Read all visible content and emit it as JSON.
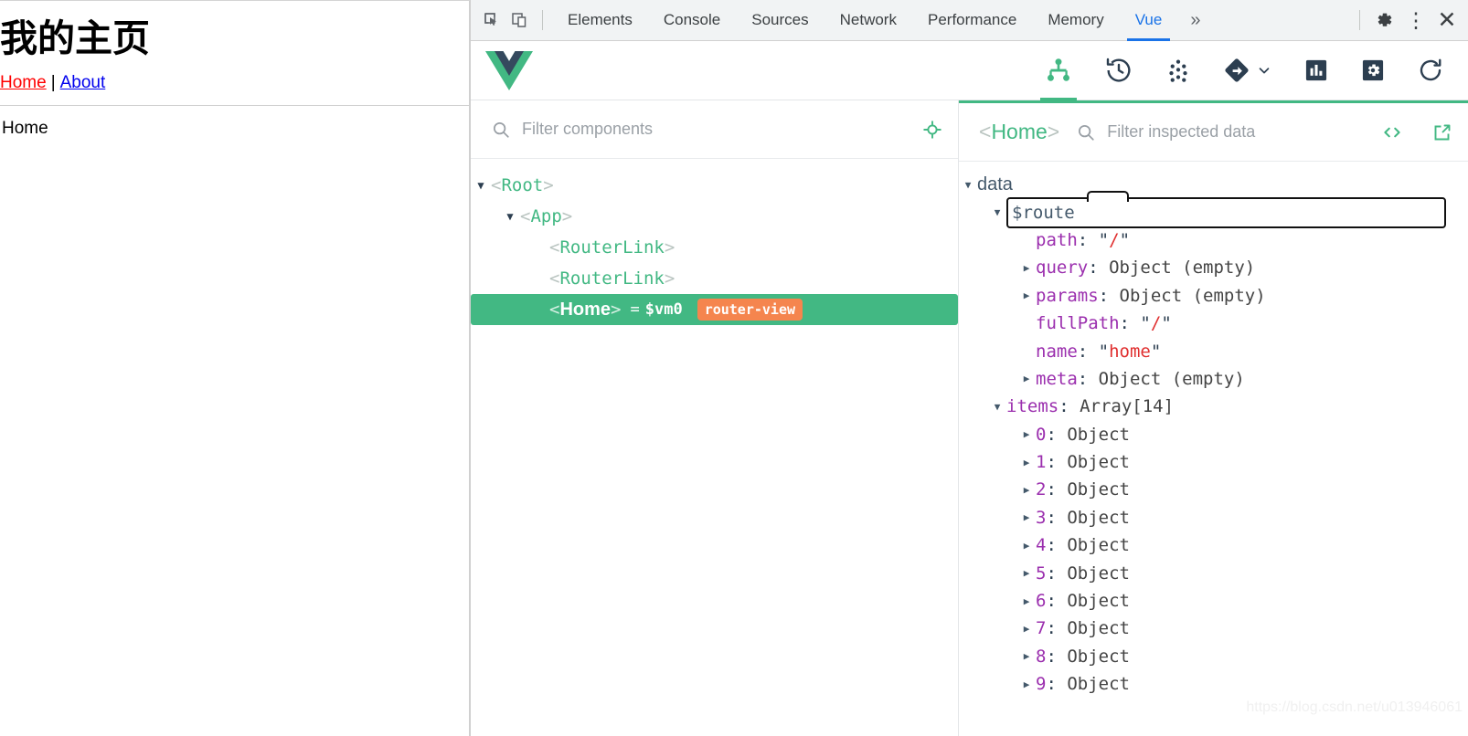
{
  "page": {
    "heading": "我的主页",
    "nav": {
      "home": "Home",
      "separator": "|",
      "about": "About"
    },
    "body_text": "Home"
  },
  "devtools": {
    "tabs": [
      {
        "label": "Elements",
        "active": false
      },
      {
        "label": "Console",
        "active": false
      },
      {
        "label": "Sources",
        "active": false
      },
      {
        "label": "Network",
        "active": false
      },
      {
        "label": "Performance",
        "active": false
      },
      {
        "label": "Memory",
        "active": false
      },
      {
        "label": "Vue",
        "active": true
      }
    ],
    "more_label": "»",
    "icons": {
      "inspect": "inspect-element-icon",
      "device": "device-toolbar-icon",
      "settings": "gear-icon",
      "menu": "kebab-menu-icon",
      "close": "close-icon"
    }
  },
  "vue_toolbar": {
    "logo": "vue-logo",
    "tools": [
      {
        "name": "components-tree-icon",
        "active": true
      },
      {
        "name": "timeline-history-icon",
        "active": false
      },
      {
        "name": "vuex-dots-icon",
        "active": false
      },
      {
        "name": "routes-icon",
        "active": false,
        "has_chevron": true
      },
      {
        "name": "performance-bars-icon",
        "active": false
      },
      {
        "name": "settings-gear-icon",
        "active": false
      },
      {
        "name": "refresh-icon",
        "active": false
      }
    ]
  },
  "components_pane": {
    "filter_placeholder": "Filter components",
    "filter_value": "",
    "select_icon": "crosshair-target-icon",
    "tree": [
      {
        "indent": 0,
        "arrow": "down",
        "name": "Root",
        "selected": false
      },
      {
        "indent": 1,
        "arrow": "down",
        "name": "App",
        "selected": false
      },
      {
        "indent": 2,
        "arrow": "none",
        "name": "RouterLink",
        "selected": false
      },
      {
        "indent": 2,
        "arrow": "none",
        "name": "RouterLink",
        "selected": false
      },
      {
        "indent": 2,
        "arrow": "none",
        "name": "Home",
        "selected": true,
        "vm": "$vm0",
        "badge": "router-view"
      }
    ]
  },
  "inspector_pane": {
    "inspected_component": "Home",
    "filter_placeholder": "Filter inspected data",
    "filter_value": "",
    "code_icon": "open-in-editor-icon",
    "external_icon": "open-external-icon",
    "rows": [
      {
        "indent": 0,
        "arrow": "down",
        "key": "data",
        "key_style": "root"
      },
      {
        "indent": 1,
        "arrow": "down",
        "key": "$route",
        "key_style": "sub",
        "boxed": true
      },
      {
        "indent": 2,
        "arrow": "none",
        "key": "path",
        "value": "/",
        "value_type": "string"
      },
      {
        "indent": 2,
        "arrow": "right",
        "key": "query",
        "value": "Object (empty)",
        "value_type": "object"
      },
      {
        "indent": 2,
        "arrow": "right",
        "key": "params",
        "value": "Object (empty)",
        "value_type": "object"
      },
      {
        "indent": 2,
        "arrow": "none",
        "key": "fullPath",
        "value": "/",
        "value_type": "string"
      },
      {
        "indent": 2,
        "arrow": "none",
        "key": "name",
        "value": "home",
        "value_type": "string"
      },
      {
        "indent": 2,
        "arrow": "right",
        "key": "meta",
        "value": "Object (empty)",
        "value_type": "object"
      },
      {
        "indent": 1,
        "arrow": "down",
        "key": "items",
        "value": "Array[14]",
        "value_type": "object"
      },
      {
        "indent": 2,
        "arrow": "right",
        "key": "0",
        "key_style": "index",
        "value": "Object",
        "value_type": "object"
      },
      {
        "indent": 2,
        "arrow": "right",
        "key": "1",
        "key_style": "index",
        "value": "Object",
        "value_type": "object"
      },
      {
        "indent": 2,
        "arrow": "right",
        "key": "2",
        "key_style": "index",
        "value": "Object",
        "value_type": "object"
      },
      {
        "indent": 2,
        "arrow": "right",
        "key": "3",
        "key_style": "index",
        "value": "Object",
        "value_type": "object"
      },
      {
        "indent": 2,
        "arrow": "right",
        "key": "4",
        "key_style": "index",
        "value": "Object",
        "value_type": "object"
      },
      {
        "indent": 2,
        "arrow": "right",
        "key": "5",
        "key_style": "index",
        "value": "Object",
        "value_type": "object"
      },
      {
        "indent": 2,
        "arrow": "right",
        "key": "6",
        "key_style": "index",
        "value": "Object",
        "value_type": "object"
      },
      {
        "indent": 2,
        "arrow": "right",
        "key": "7",
        "key_style": "index",
        "value": "Object",
        "value_type": "object"
      },
      {
        "indent": 2,
        "arrow": "right",
        "key": "8",
        "key_style": "index",
        "value": "Object",
        "value_type": "object"
      },
      {
        "indent": 2,
        "arrow": "right",
        "key": "9",
        "key_style": "index",
        "value": "Object",
        "value_type": "object"
      }
    ]
  },
  "watermark": "https://blog.csdn.net/u013946061",
  "colors": {
    "vue_green": "#42b883",
    "router_view_orange": "#f5854e",
    "chrome_blue": "#1a73e8",
    "key_purple": "#9b2fae",
    "string_red": "#e02f2f",
    "slate": "#44596b",
    "link_red": "#ff0000",
    "link_blue": "#0000ee"
  }
}
